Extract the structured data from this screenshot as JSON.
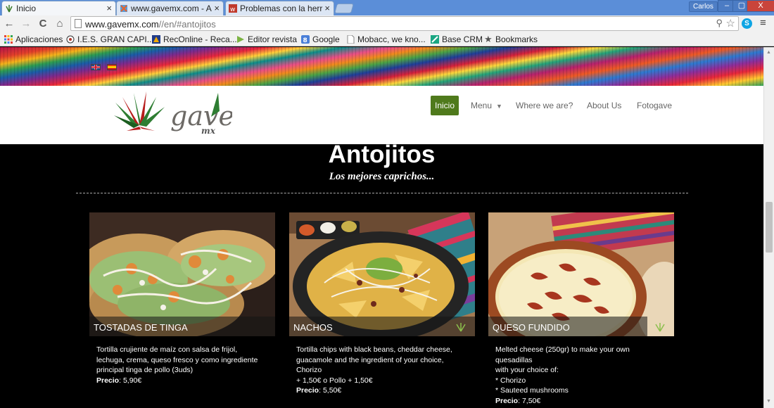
{
  "browser": {
    "tabs": [
      {
        "title": "Inicio",
        "active": true
      },
      {
        "title": "www.gavemx.com - A",
        "active": false
      },
      {
        "title": "Problemas con la herr",
        "active": false
      }
    ],
    "user": "Carlos",
    "window_buttons": {
      "minimize": "–",
      "restore": "▢",
      "close": "X"
    },
    "nav": {
      "back": "←",
      "forward": "→",
      "reload": "C",
      "home": "⌂"
    },
    "url_host": "www.gavemx.com",
    "url_path": "//en/#antojitos",
    "bookmarks": [
      {
        "label": "Aplicaciones",
        "icon": "apps-grid-icon"
      },
      {
        "label": "I.E.S. GRAN CAPI...",
        "icon": "school-icon"
      },
      {
        "label": "RecOnline - Reca...",
        "icon": "reconline-icon"
      },
      {
        "label": "Editor revista",
        "icon": "editor-icon"
      },
      {
        "label": "Google",
        "icon": "google-icon"
      },
      {
        "label": "Mobacc, we kno...",
        "icon": "page-icon"
      },
      {
        "label": "Base CRM",
        "icon": "crm-icon"
      },
      {
        "label": "Bookmarks",
        "icon": "star-icon"
      }
    ]
  },
  "site": {
    "logo_text": "gave",
    "logo_sub": "mx",
    "nav": [
      {
        "label": "Inicio",
        "active": true
      },
      {
        "label": "Menu",
        "active": false,
        "dropdown": true
      },
      {
        "label": "Where we are?",
        "active": false
      },
      {
        "label": "About Us",
        "active": false
      },
      {
        "label": "Fotogave",
        "active": false
      }
    ],
    "section": {
      "title": "Antojitos",
      "subtitle": "Los mejores caprichos..."
    },
    "dishes": [
      {
        "name": "TOSTADAS DE TINGA",
        "desc_lines": [
          "Tortilla crujiente de maíz con salsa de frijol,",
          "lechuga, crema, queso fresco y como ingrediente",
          "principal tinga de pollo (3uds)"
        ],
        "price_label": "Precio",
        "price": ": 5,90€"
      },
      {
        "name": "NACHOS",
        "desc_lines": [
          "Tortilla chips with black beans, cheddar cheese,",
          "guacamole and the ingredient of your choice, Chorizo",
          "+ 1,50€ o Pollo + 1,50€"
        ],
        "price_label": "Precio",
        "price": ": 5,50€"
      },
      {
        "name": "QUESO FUNDIDO",
        "desc_lines": [
          "Melted cheese (250gr) to make your own quesadillas",
          "with your choice of:",
          "* Chorizo",
          "* Sauteed mushrooms"
        ],
        "price_label": "Precio",
        "price": ": 7,50€"
      }
    ]
  },
  "colors": {
    "nav_active": "#4f7a1c",
    "page_bg": "#000000",
    "header_bg": "#ffffff"
  }
}
